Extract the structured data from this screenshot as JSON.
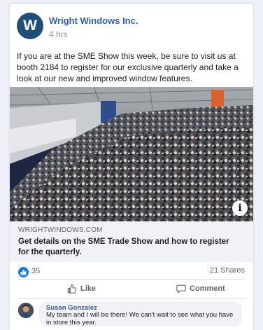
{
  "post": {
    "page_avatar_letter": "W",
    "page_name": "Wright Windows Inc.",
    "time": "4 hrs",
    "text": "If you are at the SME Show this week, be sure to visit us at booth 2184 to register for our exclusive quarterly and take a look at our new and improved window features.",
    "photo_info_label": "i"
  },
  "link_preview": {
    "domain": "WRIGHTWINDOWS.COM",
    "title": "Get details on the SME Trade Show and how to register for the quarterly."
  },
  "stats": {
    "likes": "35",
    "shares": "21 Shares"
  },
  "actions": {
    "like": "Like",
    "comment": "Comment"
  },
  "comment": {
    "author": "Susan Gonzalez",
    "text": "My team and I will be there! We can't wait to see what you have in store this year."
  },
  "colors": {
    "brand_avatar": "#1f4e79",
    "link_blue": "#2d5fb1",
    "like_blue": "#1877f2"
  }
}
